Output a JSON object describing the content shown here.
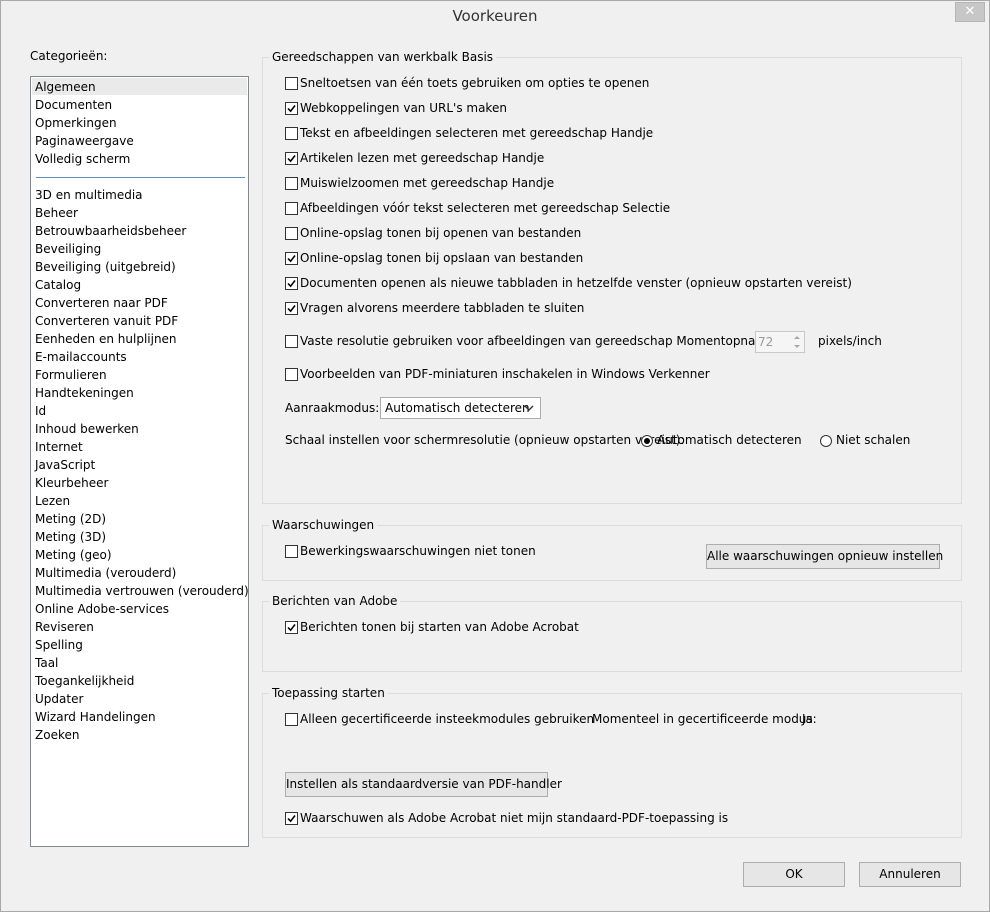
{
  "window": {
    "title": "Voorkeuren",
    "close_symbol": "✕"
  },
  "categories": {
    "heading": "Categorieën:",
    "top_items": [
      "Algemeen",
      "Documenten",
      "Opmerkingen",
      "Paginaweergave",
      "Volledig scherm"
    ],
    "items": [
      "3D en multimedia",
      "Beheer",
      "Betrouwbaarheidsbeheer",
      "Beveiliging",
      "Beveiliging (uitgebreid)",
      "Catalog",
      "Converteren naar PDF",
      "Converteren vanuit PDF",
      "Eenheden en hulplijnen",
      "E-mailaccounts",
      "Formulieren",
      "Handtekeningen",
      "Id",
      "Inhoud bewerken",
      "Internet",
      "JavaScript",
      "Kleurbeheer",
      "Lezen",
      "Meting (2D)",
      "Meting (3D)",
      "Meting (geo)",
      "Multimedia (verouderd)",
      "Multimedia vertrouwen (verouderd)",
      "Online Adobe-services",
      "Reviseren",
      "Spelling",
      "Taal",
      "Toegankelijkheid",
      "Updater",
      "Wizard Handelingen",
      "Zoeken"
    ],
    "selected": "Algemeen"
  },
  "toolbar_group": {
    "title": "Gereedschappen van werkbalk Basis",
    "options": [
      {
        "label": "Sneltoetsen van één toets gebruiken om opties te openen",
        "checked": false
      },
      {
        "label": "Webkoppelingen van URL's maken",
        "checked": true
      },
      {
        "label": "Tekst en afbeeldingen selecteren met gereedschap Handje",
        "checked": false
      },
      {
        "label": "Artikelen lezen met gereedschap Handje",
        "checked": true
      },
      {
        "label": "Muiswielzoomen met gereedschap Handje",
        "checked": false
      },
      {
        "label": "Afbeeldingen vóór tekst selecteren met gereedschap Selectie",
        "checked": false
      },
      {
        "label": "Online-opslag tonen bij openen van bestanden",
        "checked": false
      },
      {
        "label": "Online-opslag tonen bij opslaan van bestanden",
        "checked": true
      },
      {
        "label": "Documenten openen als nieuwe tabbladen in hetzelfde venster (opnieuw opstarten vereist)",
        "checked": true
      },
      {
        "label": "Vragen alvorens meerdere tabbladen te sluiten",
        "checked": true
      }
    ],
    "resolution": {
      "label": "Vaste resolutie gebruiken voor afbeeldingen van gereedschap Momentopname:",
      "checked": false,
      "value": "72",
      "unit": "pixels/inch"
    },
    "thumbnails": {
      "label": "Voorbeelden van PDF-miniaturen inschakelen in Windows Verkenner",
      "checked": false
    },
    "touch_mode": {
      "label": "Aanraakmodus:",
      "selected": "Automatisch detecteren"
    },
    "scale": {
      "label": "Schaal instellen voor schermresolutie (opnieuw opstarten vereist):",
      "option_auto": "Automatisch detecteren",
      "option_none": "Niet schalen",
      "selected": "auto"
    }
  },
  "warnings_group": {
    "title": "Waarschuwingen",
    "option": {
      "label": "Bewerkingswaarschuwingen niet tonen",
      "checked": false
    },
    "reset_button": "Alle waarschuwingen opnieuw instellen"
  },
  "adobe_group": {
    "title": "Berichten van Adobe",
    "option": {
      "label": "Berichten tonen bij starten van Adobe Acrobat",
      "checked": true
    }
  },
  "startup_group": {
    "title": "Toepassing starten",
    "certified": {
      "label": "Alleen gecertificeerde insteekmodules gebruiken",
      "checked": false
    },
    "certified_mode_label": "Momenteel in gecertificeerde modus:",
    "certified_mode_value": "Ja",
    "default_handler_button": "Instellen als standaardversie van PDF-handler",
    "warn_default": {
      "label": "Waarschuwen als Adobe Acrobat niet mijn standaard-PDF-toepassing is",
      "checked": true
    }
  },
  "footer": {
    "ok": "OK",
    "cancel": "Annuleren"
  }
}
